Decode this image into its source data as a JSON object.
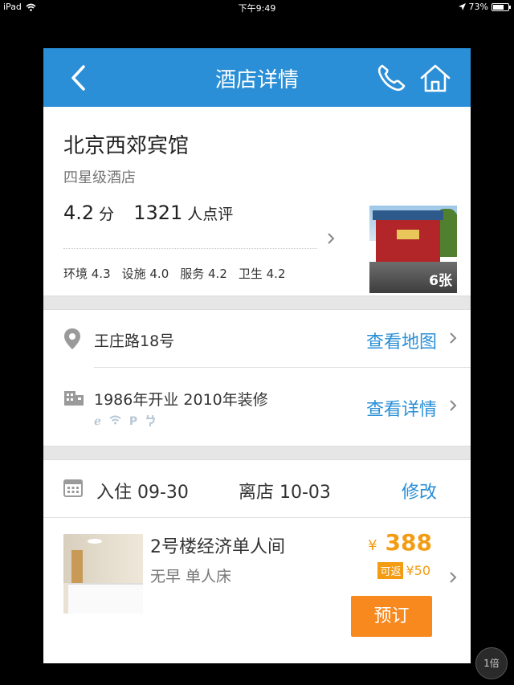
{
  "status_bar": {
    "device": "iPad",
    "time": "下午9:49",
    "battery": "73%",
    "battery_level": 0.73
  },
  "navbar": {
    "title": "酒店详情"
  },
  "hotel": {
    "name": "北京西郊宾馆",
    "star_level": "四星级酒店",
    "rating": "4.2",
    "rating_unit": "分",
    "review_count": "1321",
    "review_label": "人点评",
    "subscores": [
      "环境 4.3",
      "设施 4.0",
      "服务 4.2",
      "卫生 4.2"
    ],
    "photo_count": "6张"
  },
  "address": {
    "text": "王庄路18号",
    "link": "查看地图"
  },
  "info": {
    "text": "1986年开业 2010年装修",
    "link": "查看详情",
    "amenities": [
      "e",
      "wifi",
      "P",
      "plug"
    ]
  },
  "dates": {
    "checkin": "入住  09-30",
    "checkout": "离店  10-03",
    "edit": "修改"
  },
  "room": {
    "name": "2号楼经济单人间",
    "desc": "无早 单人床",
    "currency": "¥",
    "price": "388",
    "rebate_tag": "可返",
    "rebate": "¥50",
    "book": "预订"
  },
  "zoom": "1倍",
  "colors": {
    "primary": "#2a8fd6",
    "accent": "#f7891f",
    "price": "#f39c12"
  }
}
